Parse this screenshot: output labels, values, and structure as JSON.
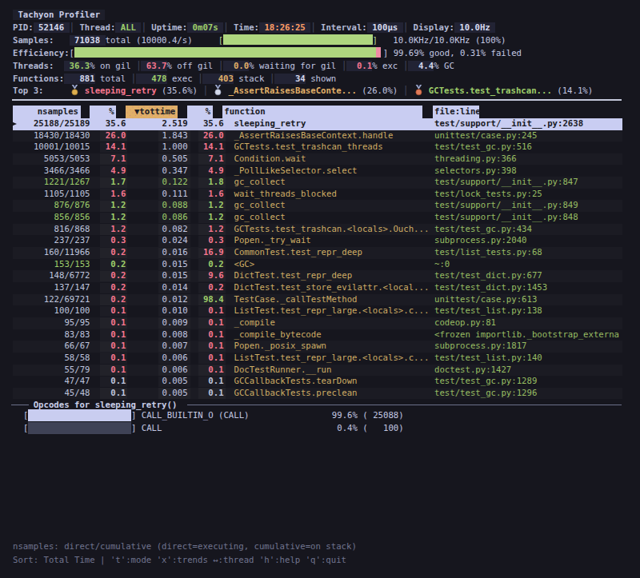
{
  "app": {
    "title": " Tachyon Profiler "
  },
  "status_lines": {
    "pid": [
      {
        "t": "PID:",
        "s": "label"
      },
      {
        "t": " 52146 ",
        "s": "box-white"
      },
      {
        "t": "│",
        "s": "sep"
      },
      {
        "t": " Thread:",
        "s": "label"
      },
      {
        "t": " ALL ",
        "s": "box-green"
      },
      {
        "t": "│",
        "s": "sep"
      },
      {
        "t": " Uptime:",
        "s": "label"
      },
      {
        "t": " 0m07s ",
        "s": "box-green"
      },
      {
        "t": "│",
        "s": "sep"
      },
      {
        "t": " Time:",
        "s": "label"
      },
      {
        "t": " 18:26:25 ",
        "s": "box-torange"
      },
      {
        "t": "│",
        "s": "sep"
      },
      {
        "t": " Interval:",
        "s": "label"
      },
      {
        "t": " 100µs ",
        "s": "box-white"
      },
      {
        "t": "│",
        "s": "sep"
      },
      {
        "t": " Display:",
        "s": "label"
      },
      {
        "t": " 10.0Hz ",
        "s": "box-white"
      }
    ],
    "samples": [
      {
        "t": "Samples:",
        "s": "label"
      },
      {
        "t": "   ",
        "s": "text"
      },
      {
        "t": " 71038 ",
        "s": "box-white"
      },
      {
        "t": "total (10000.4/s)",
        "s": "text"
      },
      {
        "t": "     ",
        "s": "text"
      },
      {
        "t": "[",
        "s": "bracket-green"
      },
      {
        "t": "",
        "s": "samples-bar"
      },
      {
        "t": "]",
        "s": "bracket-green"
      },
      {
        "t": "   ",
        "s": "text"
      },
      {
        "t": "10.0KHz/10.0KHz (100%)",
        "s": "text"
      }
    ],
    "efficiency": [
      {
        "t": "Efficiency:",
        "s": "label"
      },
      {
        "t": "[",
        "s": "text"
      },
      {
        "t": "",
        "s": "eff-bar-good"
      },
      {
        "t": "",
        "s": "eff-bar-bad"
      },
      {
        "t": "]",
        "s": "text"
      },
      {
        "t": " ",
        "s": "text"
      },
      {
        "t": "99.69% good, 0.31% failed",
        "s": "text"
      }
    ],
    "threads": [
      {
        "t": "Threads:",
        "s": "label"
      },
      {
        "t": "  ",
        "s": "text"
      },
      {
        "t": " 36.3",
        "s": "box-green"
      },
      {
        "t": "% on gil ",
        "s": "text"
      },
      {
        "t": "│",
        "s": "sep"
      },
      {
        "t": " 63.7",
        "s": "box-pink"
      },
      {
        "t": "% off gil ",
        "s": "text"
      },
      {
        "t": "│",
        "s": "sep"
      },
      {
        "t": "  0.0",
        "s": "box-orange"
      },
      {
        "t": "% waiting for gil ",
        "s": "text"
      },
      {
        "t": "│",
        "s": "sep"
      },
      {
        "t": "  0.1",
        "s": "box-pink"
      },
      {
        "t": "% exc ",
        "s": "text"
      },
      {
        "t": "│",
        "s": "sep"
      },
      {
        "t": "  4.4",
        "s": "box-white"
      },
      {
        "t": "% GC",
        "s": "text"
      }
    ],
    "functions": [
      {
        "t": "Functions:",
        "s": "label"
      },
      {
        "t": "   881",
        "s": "box-white"
      },
      {
        "t": " total ",
        "s": "text"
      },
      {
        "t": "│",
        "s": "sep"
      },
      {
        "t": "   478",
        "s": "box-green"
      },
      {
        "t": " exec ",
        "s": "text"
      },
      {
        "t": "│",
        "s": "sep"
      },
      {
        "t": "   403",
        "s": "box-orange"
      },
      {
        "t": " stack ",
        "s": "text"
      },
      {
        "t": "│",
        "s": "sep"
      },
      {
        "t": "    34",
        "s": "box-white"
      },
      {
        "t": " shown",
        "s": "text"
      }
    ],
    "top3": [
      {
        "t": "Top 3:",
        "s": "label"
      },
      {
        "t": "     ",
        "s": "text"
      },
      {
        "t": "gold-medal-icon",
        "s": "medal-gold"
      },
      {
        "t": " ",
        "s": "text"
      },
      {
        "t": "sleeping_retry",
        "s": "name-pink"
      },
      {
        "t": " (35.6%) ",
        "s": "text"
      },
      {
        "t": "│",
        "s": "sep"
      },
      {
        "t": " ",
        "s": "text"
      },
      {
        "t": "silver-medal-icon",
        "s": "medal-silver"
      },
      {
        "t": " ",
        "s": "text"
      },
      {
        "t": "_AssertRaisesBaseConte...",
        "s": "name-orange"
      },
      {
        "t": " (26.0%) ",
        "s": "text"
      },
      {
        "t": "│",
        "s": "sep"
      },
      {
        "t": " ",
        "s": "text"
      },
      {
        "t": "bronze-medal-icon",
        "s": "medal-bronze"
      },
      {
        "t": " ",
        "s": "text"
      },
      {
        "t": "GCTests.test_trashcan...",
        "s": "name-green"
      },
      {
        "t": " (14.1%)",
        "s": "text"
      }
    ]
  },
  "table": {
    "headers": [
      "nsamples",
      "%",
      "▼tottime",
      "%",
      "function",
      "file:line"
    ],
    "sort_column": "▼tottime",
    "rows": [
      {
        "ns": "25188/25189",
        "p1": "35.6",
        "tot": "2.519",
        "p2": "35.6",
        "fn": "sleeping_retry",
        "file": "test/support/__init__.py:2638",
        "c": [
          "w",
          "w",
          "w",
          "w"
        ],
        "selected": true
      },
      {
        "ns": "18430/18430",
        "p1": "26.0",
        "tot": "1.843",
        "p2": "26.0",
        "fn": "_AssertRaisesBaseContext.handle",
        "file": "unittest/case.py:245",
        "c": [
          "w",
          "p",
          "w",
          "p"
        ]
      },
      {
        "ns": "10001/10015",
        "p1": "14.1",
        "tot": "1.000",
        "p2": "14.1",
        "fn": "GCTests.test_trashcan_threads",
        "file": "test/test_gc.py:516",
        "c": [
          "w",
          "p",
          "w",
          "p"
        ]
      },
      {
        "ns": "5053/5053",
        "p1": "7.1",
        "tot": "0.505",
        "p2": "7.1",
        "fn": "Condition.wait",
        "file": "threading.py:366",
        "c": [
          "w",
          "p",
          "w",
          "p"
        ]
      },
      {
        "ns": "3466/3466",
        "p1": "4.9",
        "tot": "0.347",
        "p2": "4.9",
        "fn": "_PollLikeSelector.select",
        "file": "selectors.py:398",
        "c": [
          "w",
          "p",
          "w",
          "p"
        ]
      },
      {
        "ns": "1221/1267",
        "p1": "1.7",
        "tot": "0.122",
        "p2": "1.8",
        "fn": "gc_collect",
        "file": "test/support/__init__.py:847",
        "c": [
          "g",
          "g",
          "g",
          "g"
        ]
      },
      {
        "ns": "1105/1105",
        "p1": "1.6",
        "tot": "0.111",
        "p2": "1.6",
        "fn": "wait_threads_blocked",
        "file": "test/lock_tests.py:25",
        "c": [
          "w",
          "p",
          "w",
          "p"
        ]
      },
      {
        "ns": "876/876",
        "p1": "1.2",
        "tot": "0.088",
        "p2": "1.2",
        "fn": "gc_collect",
        "file": "test/support/__init__.py:849",
        "c": [
          "g",
          "g",
          "g",
          "g"
        ]
      },
      {
        "ns": "856/856",
        "p1": "1.2",
        "tot": "0.086",
        "p2": "1.2",
        "fn": "gc_collect",
        "file": "test/support/__init__.py:848",
        "c": [
          "g",
          "g",
          "g",
          "g"
        ]
      },
      {
        "ns": "816/868",
        "p1": "1.2",
        "tot": "0.082",
        "p2": "1.2",
        "fn": "GCTests.test_trashcan.<locals>.Ouch...",
        "file": "test/test_gc.py:434",
        "c": [
          "w",
          "p",
          "w",
          "p"
        ]
      },
      {
        "ns": "237/237",
        "p1": "0.3",
        "tot": "0.024",
        "p2": "0.3",
        "fn": "Popen._try_wait",
        "file": "subprocess.py:2040",
        "c": [
          "w",
          "p",
          "w",
          "p"
        ]
      },
      {
        "ns": "160/11966",
        "p1": "0.2",
        "tot": "0.016",
        "p2": "16.9",
        "fn": "CommonTest.test_repr_deep",
        "file": "test/list_tests.py:68",
        "c": [
          "w",
          "p",
          "w",
          "p"
        ]
      },
      {
        "ns": "153/153",
        "p1": "0.2",
        "tot": "0.015",
        "p2": "0.2",
        "fn": "<GC>",
        "file": "~:0",
        "c": [
          "g",
          "g",
          "w",
          "g"
        ]
      },
      {
        "ns": "148/6772",
        "p1": "0.2",
        "tot": "0.015",
        "p2": "9.6",
        "fn": "DictTest.test_repr_deep",
        "file": "test/test_dict.py:677",
        "c": [
          "w",
          "p",
          "w",
          "p"
        ]
      },
      {
        "ns": "137/147",
        "p1": "0.2",
        "tot": "0.014",
        "p2": "0.2",
        "fn": "DictTest.test_store_evilattr.<local...",
        "file": "test/test_dict.py:1453",
        "c": [
          "w",
          "p",
          "w",
          "p"
        ]
      },
      {
        "ns": "122/69721",
        "p1": "0.2",
        "tot": "0.012",
        "p2": "98.4",
        "fn": "TestCase._callTestMethod",
        "file": "unittest/case.py:613",
        "c": [
          "w",
          "p",
          "w",
          "g"
        ]
      },
      {
        "ns": "100/100",
        "p1": "0.1",
        "tot": "0.010",
        "p2": "0.1",
        "fn": "ListTest.test_repr_large.<locals>.c...",
        "file": "test/test_list.py:138",
        "c": [
          "w",
          "p",
          "w",
          "p"
        ]
      },
      {
        "ns": "95/95",
        "p1": "0.1",
        "tot": "0.009",
        "p2": "0.1",
        "fn": "_compile",
        "file": "codeop.py:81",
        "c": [
          "w",
          "p",
          "w",
          "p"
        ]
      },
      {
        "ns": "83/83",
        "p1": "0.1",
        "tot": "0.008",
        "p2": "0.1",
        "fn": "_compile_bytecode",
        "file": "<frozen importlib._bootstrap_externa",
        "c": [
          "w",
          "p",
          "w",
          "p"
        ]
      },
      {
        "ns": "66/67",
        "p1": "0.1",
        "tot": "0.007",
        "p2": "0.1",
        "fn": "Popen._posix_spawn",
        "file": "subprocess.py:1817",
        "c": [
          "w",
          "p",
          "w",
          "p"
        ]
      },
      {
        "ns": "58/58",
        "p1": "0.1",
        "tot": "0.006",
        "p2": "0.1",
        "fn": "ListTest.test_repr_large.<locals>.c...",
        "file": "test/test_list.py:140",
        "c": [
          "w",
          "p",
          "w",
          "p"
        ]
      },
      {
        "ns": "55/79",
        "p1": "0.1",
        "tot": "0.006",
        "p2": "0.1",
        "fn": "DocTestRunner.__run",
        "file": "doctest.py:1427",
        "c": [
          "w",
          "p",
          "w",
          "p"
        ]
      },
      {
        "ns": "47/47",
        "p1": "0.1",
        "tot": "0.005",
        "p2": "0.1",
        "fn": "GCCallbackTests.tearDown",
        "file": "test/test_gc.py:1289",
        "c": [
          "w",
          "w",
          "w",
          "w"
        ]
      },
      {
        "ns": "45/48",
        "p1": "0.1",
        "tot": "0.005",
        "p2": "0.1",
        "fn": "GCCallbackTests.preclean",
        "file": "test/test_gc.py:1296",
        "c": [
          "w",
          "w",
          "w",
          "w"
        ]
      }
    ]
  },
  "opcodes": {
    "title": "Opcodes for sleeping_retry()",
    "rows": [
      {
        "name": "CALL_BUILTIN_O (CALL)",
        "stat": "99.6% ( 25088)",
        "filled": true
      },
      {
        "name": "CALL",
        "stat": "0.4% (   100)",
        "filled": false
      }
    ]
  },
  "footer": {
    "line1": "nsamples: direct/cumulative (direct=executing, cumulative=on stack)",
    "line2": "Sort: Total Time | 't':mode 'x':trends ↔:thread 'h':help 'q':quit"
  },
  "colors": {
    "background": "#16161e",
    "foreground": "#c3c8e2",
    "selection": "#c9cdf2",
    "green": "#9ece6a",
    "red": "#f7768e",
    "orange": "#e0af68",
    "bright_orange": "#ff9e64",
    "function": "#cfad64",
    "file": "#97bd62",
    "bar_green": "#aed67f",
    "bar_pink": "#ee8ca5",
    "opcode_bar_filled": "#c9cdf0",
    "opcode_bar_empty": "#3f4256",
    "muted": "#70748e"
  }
}
